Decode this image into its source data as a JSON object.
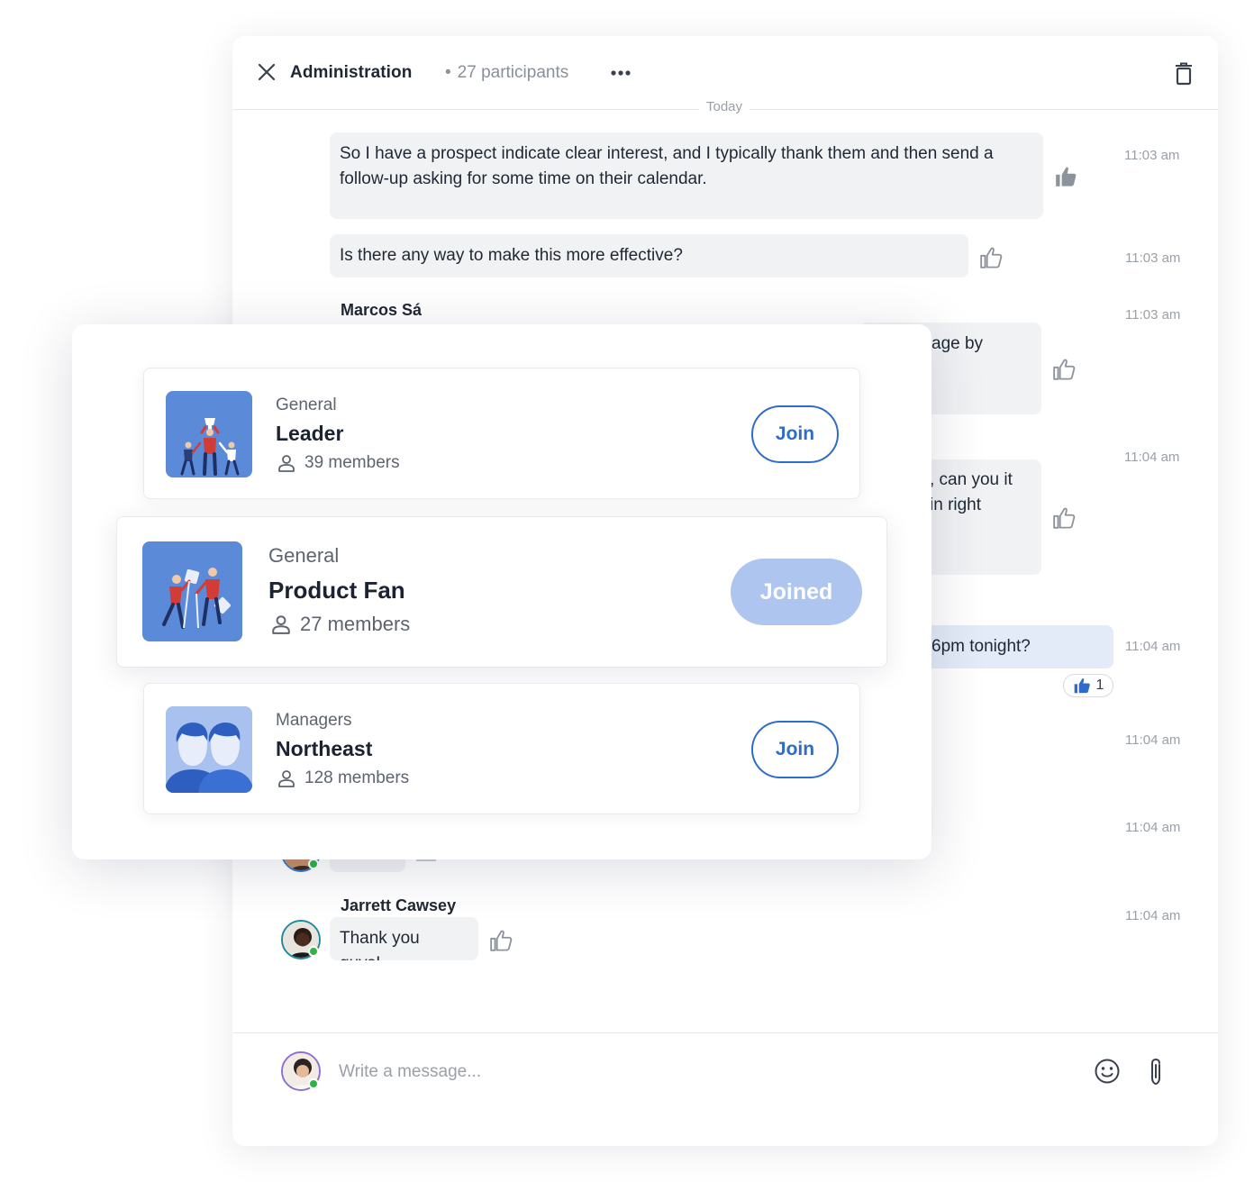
{
  "chat": {
    "title": "Administration",
    "participants": "27 participants",
    "date_divider": "Today",
    "composer_placeholder": "Write a message...",
    "messages": [
      {
        "text": "So I have a prospect indicate clear interest, and I typically thank them and then send a follow-up asking for some time on their calendar.",
        "time": "11:03 am"
      },
      {
        "text": "Is there any way to make this more effective?",
        "time": "11:03 am"
      },
      {
        "sender": "Marcos Sá",
        "text": "age by",
        "time": "11:03 am"
      },
      {
        "text": ", can you it in right",
        "time": "11:04 am"
      },
      {
        "text": "6pm tonight?",
        "time": "11:04 am",
        "reaction_count": "1"
      },
      {
        "time": "11:04 am"
      },
      {
        "time": "11:04 am"
      },
      {
        "sender": "Jarrett Cawsey",
        "text": "Thank you guys!",
        "time": "11:04 am"
      }
    ]
  },
  "groups": [
    {
      "category": "General",
      "name": "Leader",
      "members": "39 members",
      "button": "Join"
    },
    {
      "category": "General",
      "name": "Product Fan",
      "members": "27 members",
      "button": "Joined"
    },
    {
      "category": "Managers",
      "name": "Northeast",
      "members": "128 members",
      "button": "Join"
    }
  ],
  "colors": {
    "accent": "#2e6cc7",
    "joined_button": "#aec5f0",
    "thumbnail_blue": "#5b8ad8",
    "bubble_grey": "#f1f2f4",
    "bubble_blue": "#e3ebf8",
    "online": "#2fb344"
  }
}
